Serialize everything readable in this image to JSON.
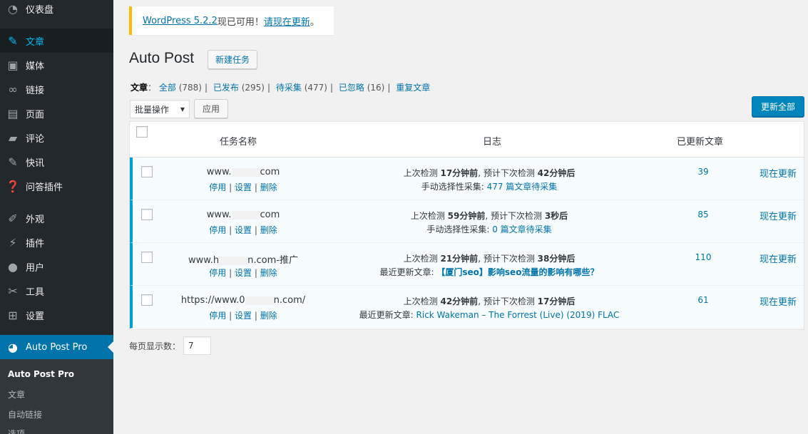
{
  "sidebar": {
    "items": [
      {
        "label": "仪表盘",
        "icon": "dashboard-icon"
      },
      {
        "label": "文章",
        "icon": "pin-icon"
      },
      {
        "label": "媒体",
        "icon": "media-icon"
      },
      {
        "label": "链接",
        "icon": "link-icon"
      },
      {
        "label": "页面",
        "icon": "page-icon"
      },
      {
        "label": "评论",
        "icon": "comment-icon"
      },
      {
        "label": "快讯",
        "icon": "pin-icon"
      },
      {
        "label": "问答插件",
        "icon": "help-icon"
      },
      {
        "label": "外观",
        "icon": "brush-icon"
      },
      {
        "label": "插件",
        "icon": "plugin-icon"
      },
      {
        "label": "用户",
        "icon": "user-icon"
      },
      {
        "label": "工具",
        "icon": "wrench-icon"
      },
      {
        "label": "设置",
        "icon": "settings-icon"
      },
      {
        "label": "Auto Post Pro",
        "icon": "autopost-icon"
      }
    ],
    "submenu": [
      "Auto Post Pro",
      "文章",
      "自动链接",
      "选项"
    ]
  },
  "notice": {
    "link_version": "WordPress 5.2.2",
    "text_mid": "现已可用！",
    "link_update": "请现在更新",
    "text_end": "。"
  },
  "page": {
    "title": "Auto Post",
    "new_task": "新建任务"
  },
  "filters": {
    "prefix": "文章",
    "colon": "：",
    "items": [
      {
        "label": "全部",
        "count": "(788)"
      },
      {
        "label": "已发布",
        "count": "(295)"
      },
      {
        "label": "待采集",
        "count": "(477)"
      },
      {
        "label": "已忽略",
        "count": "(16)"
      },
      {
        "label": "重复文章",
        "count": ""
      }
    ]
  },
  "bulk": {
    "select_value": "批量操作",
    "apply": "应用",
    "update_all": "更新全部"
  },
  "table": {
    "headers": {
      "name": "任务名称",
      "log": "日志",
      "updated": "已更新文章"
    },
    "action_labels": {
      "disable": "停用",
      "settings": "设置",
      "delete": "删除",
      "sep": "|"
    },
    "update_now": "现在更新",
    "rows": [
      {
        "name_a": "www.",
        "name_b": "com",
        "log1": {
          "a": "上次检测 ",
          "b": "17分钟前",
          "c": ", 预计下次检测 ",
          "d": "42分钟后"
        },
        "log2": {
          "prefix": "手动选择性采集: ",
          "link": "477 篇文章待采集"
        },
        "count": "39"
      },
      {
        "name_a": "www.",
        "name_b": "com",
        "log1": {
          "a": "上次检测 ",
          "b": "59分钟前",
          "c": ", 预计下次检测 ",
          "d": "3秒后"
        },
        "log2": {
          "prefix": "手动选择性采集: ",
          "link": "0 篇文章待采集"
        },
        "count": "85"
      },
      {
        "name_a": "www.h",
        "name_b": "n.com-推广",
        "log1": {
          "a": "上次检测 ",
          "b": "21分钟前",
          "c": ", 预计下次检测 ",
          "d": "38分钟后"
        },
        "log2": {
          "prefix": "最近更新文章: ",
          "link": "【厦门seo】影响seo流量的影响有哪些？"
        },
        "count": "110"
      },
      {
        "name_a": "https://www.0",
        "name_b": "n.com/",
        "log1": {
          "a": "上次检测 ",
          "b": "42分钟前",
          "c": ", 预计下次检测 ",
          "d": "17分钟后"
        },
        "log2": {
          "prefix": "最近更新文章: ",
          "link": "Rick Wakeman – The Forrest (Live) (2019) FLAC"
        },
        "count": "61"
      }
    ]
  },
  "perpage": {
    "label": "每页显示数：",
    "value": "7"
  }
}
